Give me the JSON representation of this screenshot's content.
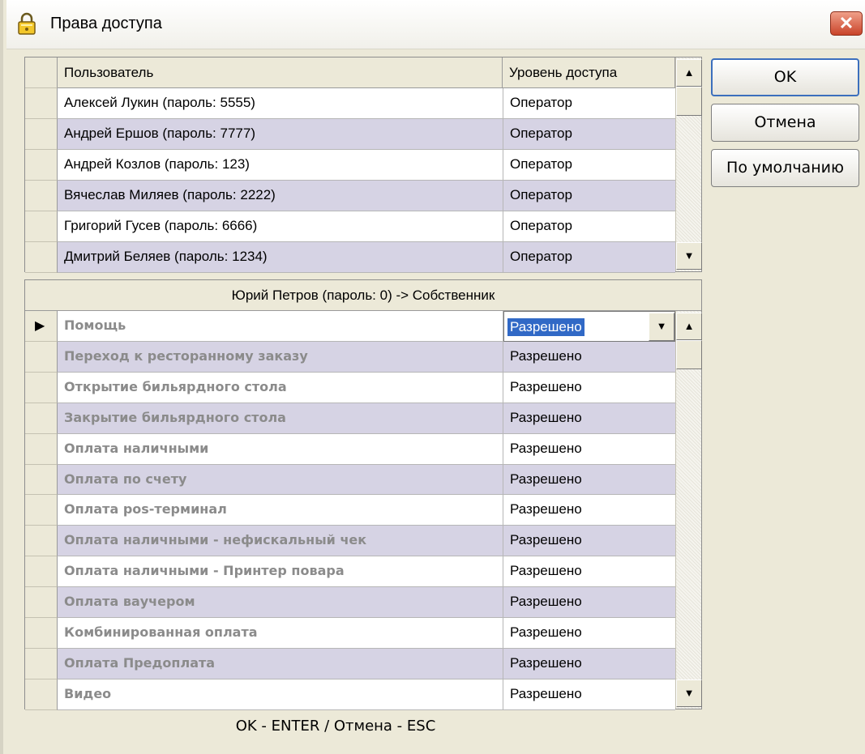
{
  "window": {
    "title": "Права доступа",
    "close_glyph": "✕"
  },
  "buttons": {
    "ok": "OK",
    "cancel": "Отмена",
    "default": "По умолчанию"
  },
  "users_table": {
    "columns": [
      "Пользователь",
      "Уровень доступа"
    ],
    "rows": [
      {
        "user": "Алексей Лукин (пароль: 5555)",
        "level": "Оператор"
      },
      {
        "user": "Андрей Ершов (пароль: 7777)",
        "level": "Оператор"
      },
      {
        "user": "Андрей Козлов (пароль: 123)",
        "level": "Оператор"
      },
      {
        "user": "Вячеслав Миляев (пароль: 2222)",
        "level": "Оператор"
      },
      {
        "user": "Григорий Гусев (пароль: 6666)",
        "level": "Оператор"
      },
      {
        "user": "Дмитрий Беляев (пароль: 1234)",
        "level": "Оператор"
      }
    ]
  },
  "permissions_table": {
    "header": "Юрий Петров (пароль: 0) -> Собственник",
    "rows": [
      {
        "name": "Помощь",
        "value": "Разрешено"
      },
      {
        "name": "Переход к ресторанному заказу",
        "value": "Разрешено"
      },
      {
        "name": "Открытие бильярдного стола",
        "value": "Разрешено"
      },
      {
        "name": "Закрытие бильярдного стола",
        "value": "Разрешено"
      },
      {
        "name": "Оплата наличными",
        "value": "Разрешено"
      },
      {
        "name": "Оплата по счету",
        "value": "Разрешено"
      },
      {
        "name": "Оплата pos-терминал",
        "value": "Разрешено"
      },
      {
        "name": "Оплата наличными - нефискальный чек",
        "value": "Разрешено"
      },
      {
        "name": "Оплата наличными - Принтер повара",
        "value": "Разрешено"
      },
      {
        "name": "Оплата ваучером",
        "value": "Разрешено"
      },
      {
        "name": "Комбинированная оплата",
        "value": "Разрешено"
      },
      {
        "name": "Оплата Предоплата",
        "value": "Разрешено"
      },
      {
        "name": "Видео",
        "value": "Разрешено"
      }
    ]
  },
  "footer": {
    "hint": "OK - ENTER / Отмена - ESC"
  },
  "icons": {
    "up": "▲",
    "down": "▼",
    "row_pointer": "▶"
  },
  "colors": {
    "row_alt": "#d6d3e4",
    "selection": "#3169c6",
    "permission_text": "#8b8b8b",
    "close_button": "#c9442a"
  }
}
